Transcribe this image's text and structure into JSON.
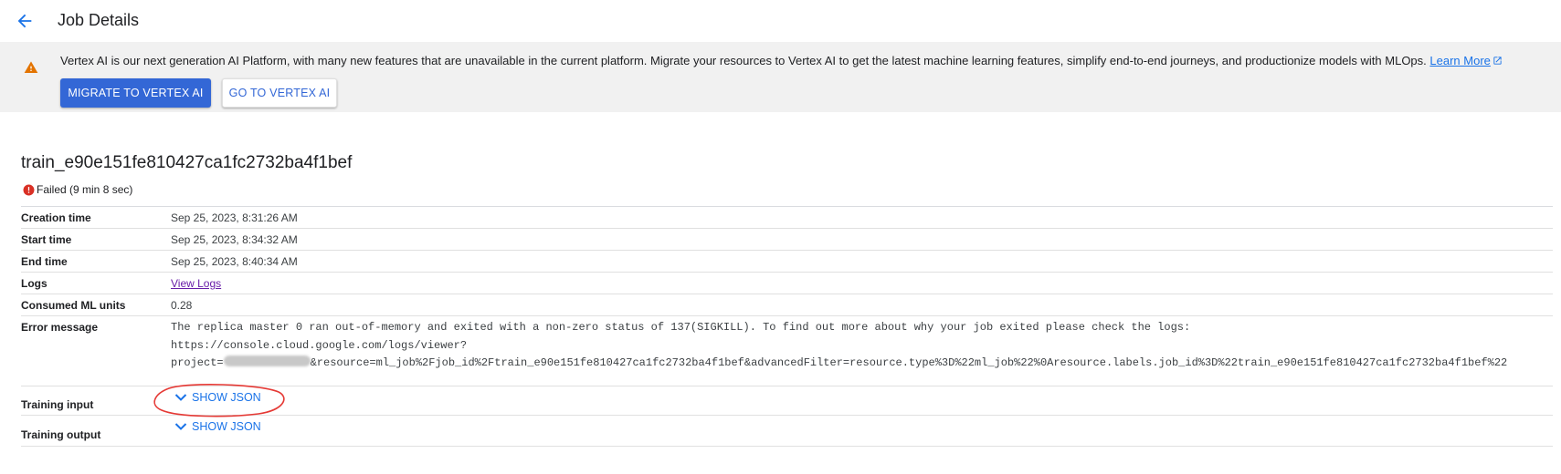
{
  "header": {
    "title": "Job Details"
  },
  "banner": {
    "message": "Vertex AI is our next generation AI Platform, with many new features that are unavailable in the current platform. Migrate your resources to Vertex AI to get the latest machine learning features, simplify end-to-end journeys, and productionize models with MLOps.",
    "learn_more": "Learn More",
    "primary_button": "MIGRATE TO VERTEX AI",
    "secondary_button": "GO TO VERTEX AI"
  },
  "job": {
    "name": "train_e90e151fe810427ca1fc2732ba4f1bef",
    "status": "Failed (9 min 8 sec)"
  },
  "details": {
    "creation_time": {
      "label": "Creation time",
      "value": "Sep 25, 2023, 8:31:26 AM"
    },
    "start_time": {
      "label": "Start time",
      "value": "Sep 25, 2023, 8:34:32 AM"
    },
    "end_time": {
      "label": "End time",
      "value": "Sep 25, 2023, 8:40:34 AM"
    },
    "logs": {
      "label": "Logs",
      "value": "View Logs"
    },
    "consumed_ml_units": {
      "label": "Consumed ML units",
      "value": "0.28"
    },
    "error_message": {
      "label": "Error message",
      "line1": "The replica master 0 ran out-of-memory and exited with a non-zero status of 137(SIGKILL). To find out more about why your job exited please check the logs:",
      "line2": "https://console.cloud.google.com/logs/viewer?",
      "line3_prefix": "project=",
      "line3_suffix": "&resource=ml_job%2Fjob_id%2Ftrain_e90e151fe810427ca1fc2732ba4f1bef&advancedFilter=resource.type%3D%22ml_job%22%0Aresource.labels.job_id%3D%22train_e90e151fe810427ca1fc2732ba4f1bef%22"
    },
    "training_input": {
      "label": "Training input",
      "action": "SHOW JSON"
    },
    "training_output": {
      "label": "Training output",
      "action": "SHOW JSON"
    }
  },
  "colors": {
    "primary": "#3367d6",
    "link": "#1a73e8",
    "warning": "#e37400",
    "error": "#d93025",
    "annotation": "#e53935"
  }
}
